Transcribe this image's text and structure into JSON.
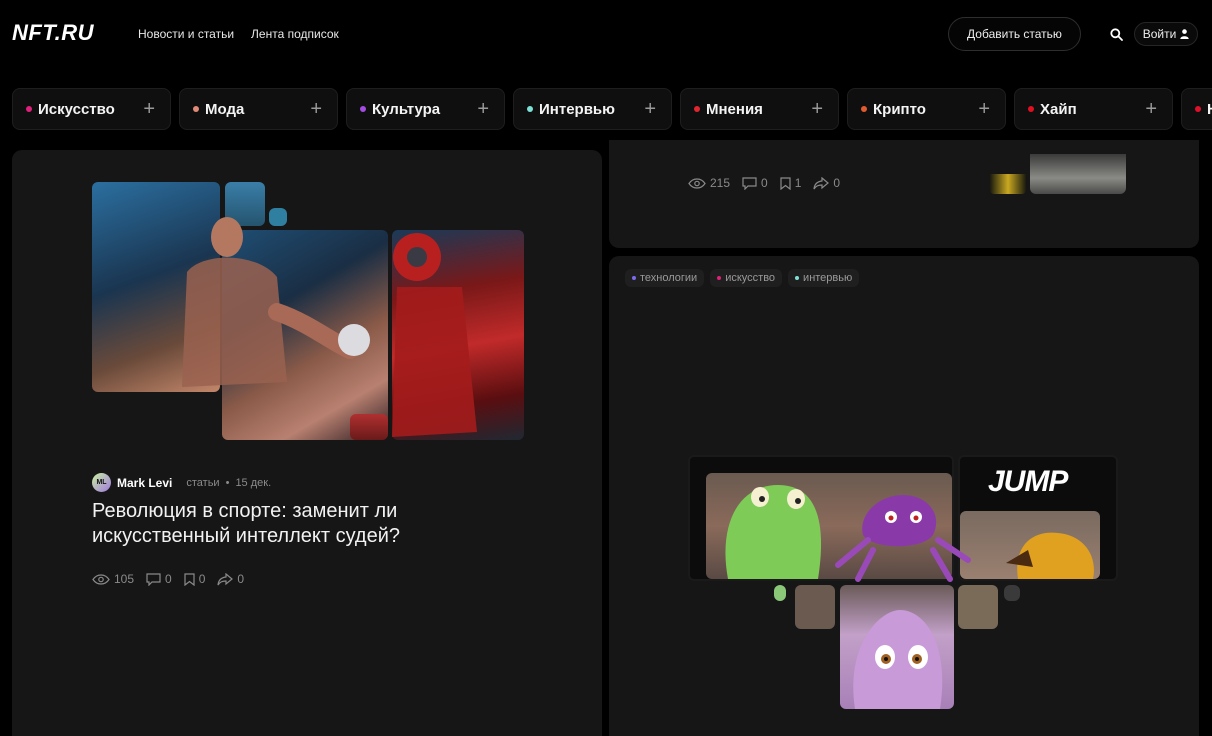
{
  "header": {
    "logo": "NFT.RU",
    "nav": [
      "Новости и статьи",
      "Лента подписок"
    ],
    "add_article": "Добавить статью",
    "login": "Войти"
  },
  "categories": [
    {
      "label": "Искусство",
      "color": "#e0207a"
    },
    {
      "label": "Мода",
      "color": "#e08a78"
    },
    {
      "label": "Культура",
      "color": "#a24ce0"
    },
    {
      "label": "Интервью",
      "color": "#7fe0d8"
    },
    {
      "label": "Мнения",
      "color": "#e0262e"
    },
    {
      "label": "Крипто",
      "color": "#e05a30"
    },
    {
      "label": "Хайп",
      "color": "#e01020"
    },
    {
      "label": "Н",
      "color": "#e0102a"
    }
  ],
  "article_main": {
    "author_initials": "ML",
    "author": "Mark Levi",
    "section": "статьи",
    "separator": "•",
    "date": "15 дек.",
    "title": "Революция в спорте: заменит ли искусственный интеллект судей?",
    "views": "105",
    "comments": "0",
    "bookmarks": "0",
    "shares": "0"
  },
  "article_top_right": {
    "views": "215",
    "comments": "0",
    "bookmarks": "1",
    "shares": "0"
  },
  "article_bottom_right": {
    "tags": [
      {
        "label": "технологии",
        "color": "#7a6cf0"
      },
      {
        "label": "искусство",
        "color": "#e0207a"
      },
      {
        "label": "интервью",
        "color": "#7fe0d8"
      }
    ],
    "image_logo": "JUMP"
  }
}
